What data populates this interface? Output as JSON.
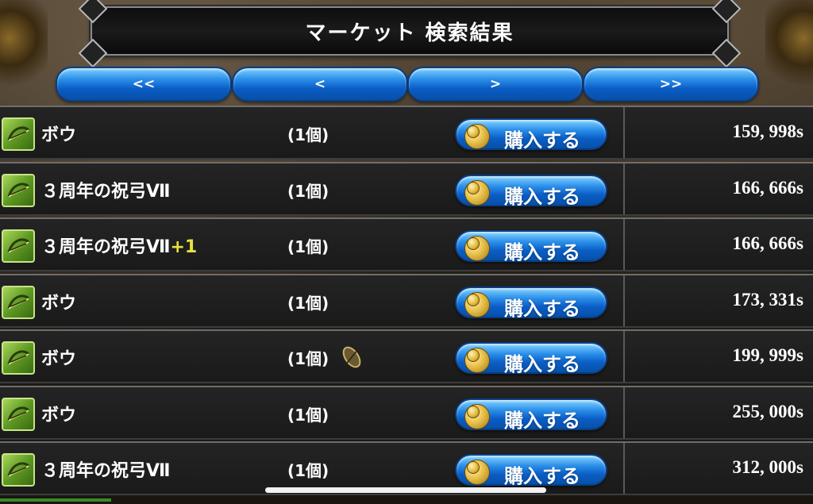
{
  "title": "マーケット 検索結果",
  "nav": [
    {
      "label": "<<"
    },
    {
      "label": "<"
    },
    {
      "label": ">"
    },
    {
      "label": ">>"
    }
  ],
  "buy_label": "購入する",
  "rows": [
    {
      "name": "ボウ",
      "plus": "",
      "qty": "(1個)",
      "leaf": false,
      "price": "159, 998s"
    },
    {
      "name": "３周年の祝弓Ⅶ",
      "plus": "",
      "qty": "(1個)",
      "leaf": false,
      "price": "166, 666s"
    },
    {
      "name": "３周年の祝弓Ⅶ",
      "plus": "+1",
      "qty": "(1個)",
      "leaf": false,
      "price": "166, 666s"
    },
    {
      "name": "ボウ",
      "plus": "",
      "qty": "(1個)",
      "leaf": false,
      "price": "173, 331s"
    },
    {
      "name": "ボウ",
      "plus": "",
      "qty": "(1個)",
      "leaf": true,
      "price": "199, 999s"
    },
    {
      "name": "ボウ",
      "plus": "",
      "qty": "(1個)",
      "leaf": false,
      "price": "255, 000s"
    },
    {
      "name": "３周年の祝弓Ⅶ",
      "plus": "",
      "qty": "(1個)",
      "leaf": false,
      "price": "312, 000s"
    }
  ],
  "icons": {
    "item": "bow-icon",
    "coin": "coin-icon",
    "leaf": "leaf-icon"
  },
  "colors": {
    "button_blue": "#0b5ec6",
    "item_green": "#5e9a22",
    "plus_yellow": "#e8e040"
  }
}
